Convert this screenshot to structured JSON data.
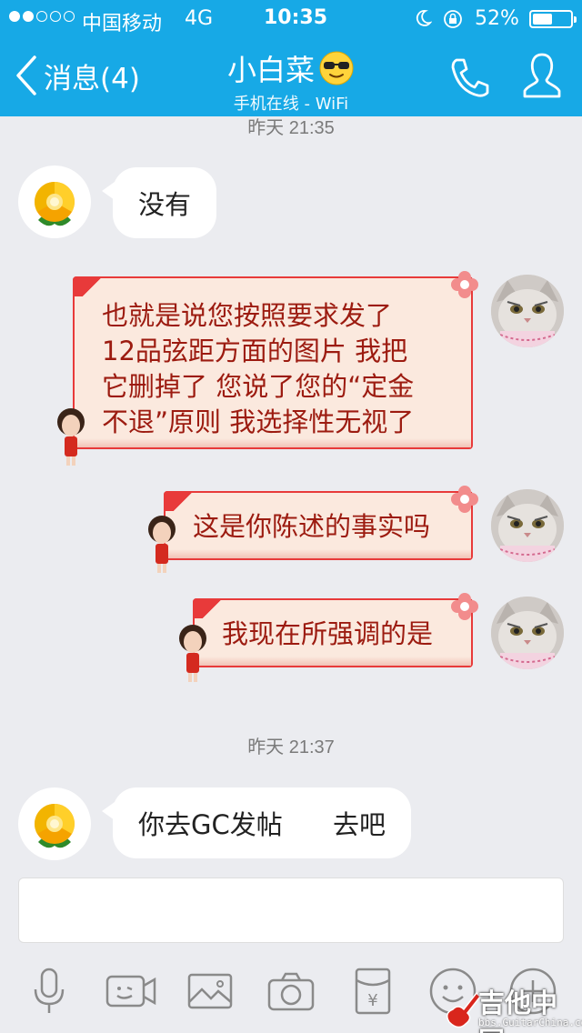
{
  "status_bar": {
    "carrier": "中国移动",
    "network": "4G",
    "time": "10:35",
    "battery_percent_text": "52%",
    "battery_level": 0.52
  },
  "nav": {
    "back_label": "消息(4)",
    "title": "小白菜",
    "subtitle": "手机在线 - WiFi"
  },
  "chat": {
    "timestamp_1": "昨天 21:35",
    "msg_1": "没有",
    "msg_2_lines": [
      "也就是说您按照要求发了",
      "12品弦距方面的图片 我把",
      "它删掉了 您说了您的“定金",
      "不退”原则 我选择性无视了"
    ],
    "msg_3": "这是你陈述的事实吗",
    "msg_4": "我现在所强调的是",
    "timestamp_2": "昨天 21:37",
    "msg_5": "你去GC发帖      去吧"
  },
  "toolbar": {
    "icons": [
      "microphone-icon",
      "video-icon",
      "image-icon",
      "camera-icon",
      "red-packet-icon",
      "emoji-icon",
      "plus-icon"
    ]
  },
  "watermark": {
    "text": "吉他中国",
    "url": "bbs.GuitarChina.com"
  },
  "colors": {
    "nav_blue": "#17a9e6",
    "bubble_border_red": "#e83a3a",
    "bubble_text_red": "#9c1b10",
    "bubble_fill": "#fbe9de",
    "chat_bg": "#ebecf0"
  }
}
